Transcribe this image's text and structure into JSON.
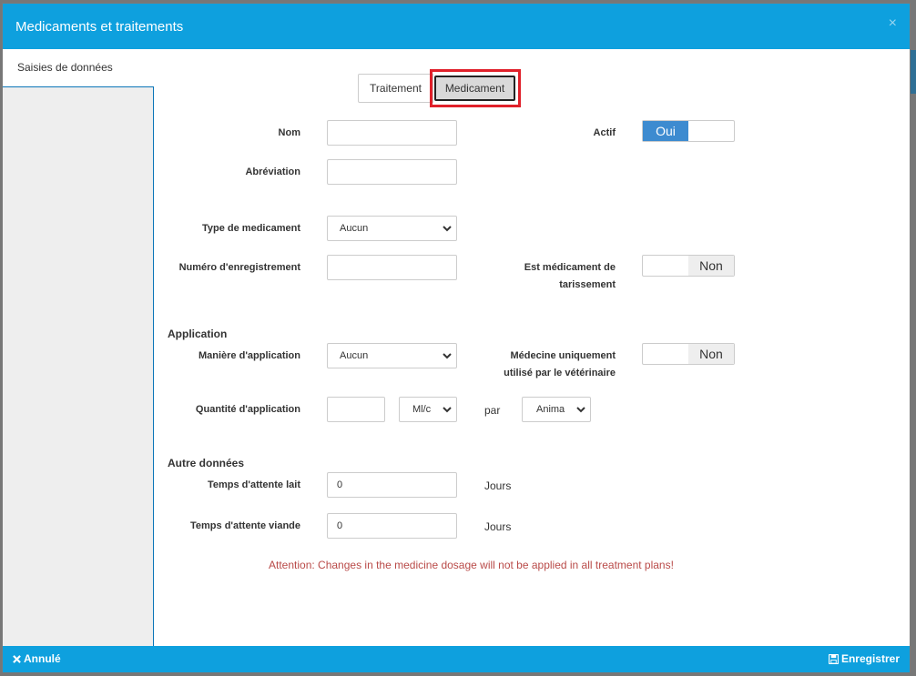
{
  "modal": {
    "title": "Medicaments et traitements",
    "close_glyph": "×"
  },
  "sidebar": {
    "tab_label": "Saisies de données"
  },
  "segmented": {
    "traitement": "Traitement",
    "medicament": "Medicament",
    "selected": "Medicament"
  },
  "form": {
    "nom_label": "Nom",
    "nom_value": "",
    "abreviation_label": "Abréviation",
    "abreviation_value": "",
    "actif_label": "Actif",
    "actif_toggle": {
      "on_label": "Oui",
      "state": "on"
    },
    "type_label": "Type de medicament",
    "type_value": "Aucun",
    "numero_label": "Numéro d'enregistrement",
    "numero_value": "",
    "tarissement_label_1": "Est médicament de",
    "tarissement_label_2": "tarissement",
    "tarissement_toggle": {
      "off_label": "Non",
      "state": "off"
    },
    "application_section": "Application",
    "maniere_label": "Manière d'application",
    "maniere_value": "Aucun",
    "veterinaire_label_1": "Médecine uniquement",
    "veterinaire_label_2": "utilisé par le vétérinaire",
    "veterinaire_toggle": {
      "off_label": "Non",
      "state": "off"
    },
    "quantite_label": "Quantité d'application",
    "quantite_value": "",
    "quantite_unit": "Ml/c",
    "par_label": "par",
    "par_value": "Anima",
    "autre_section": "Autre données",
    "lait_label": "Temps d'attente lait",
    "lait_value": "0",
    "lait_unit": "Jours",
    "viande_label": "Temps d'attente viande",
    "viande_value": "0",
    "viande_unit": "Jours",
    "warning": "Attention: Changes in the medicine dosage will not be applied in all treatment plans!"
  },
  "footer": {
    "cancel_label": "Annulé",
    "cancel_icon": "times-icon",
    "save_label": "Enregistrer",
    "save_icon": "floppy-disk-icon"
  },
  "colors": {
    "header": "#0ea0de",
    "toggle_on": "#3d8bd0",
    "highlight": "#e0202a",
    "warning": "#b94a48"
  }
}
